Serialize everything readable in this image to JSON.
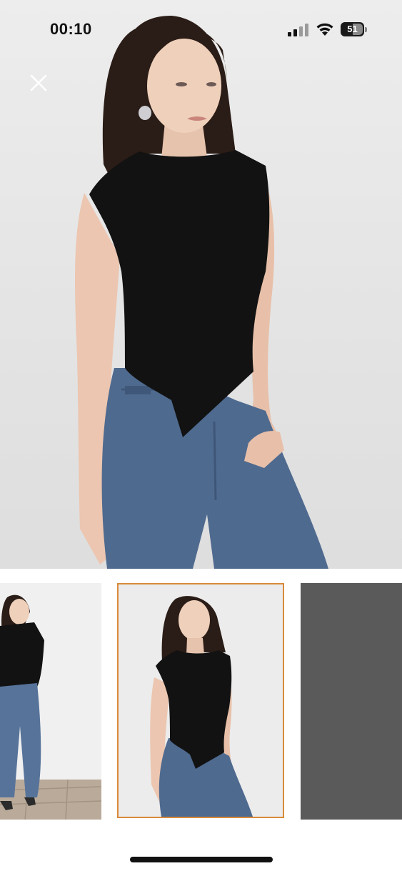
{
  "status_bar": {
    "time": "00:10",
    "battery_level": "51",
    "battery_fraction": 0.51
  },
  "icons": {
    "close": "close-icon",
    "signal": "cellular-signal-icon",
    "wifi": "wifi-icon",
    "battery": "battery-icon"
  },
  "gallery": {
    "selected_index": 1,
    "selected_border_color": "#d98a3a",
    "thumbnails": [
      {
        "name": "thumbnail-full-outfit"
      },
      {
        "name": "thumbnail-top-closeup"
      },
      {
        "name": "thumbnail-fabric-detail"
      }
    ]
  },
  "colors": {
    "top": "#121212",
    "denim": "#4f6a8f",
    "background": "#e8e8e8"
  }
}
